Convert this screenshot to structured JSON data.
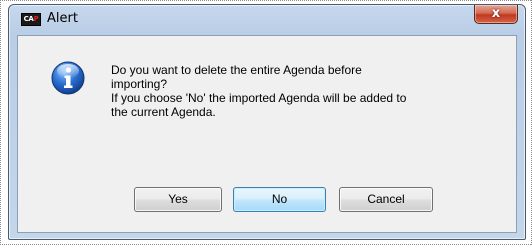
{
  "window": {
    "title": "Alert",
    "app_logo_text_white": "CA",
    "app_logo_text_red": "P"
  },
  "title_bar": {
    "close_glyph": "x"
  },
  "dialog": {
    "icon": "information-icon",
    "message_lines": [
      "Do you want to delete the entire Agenda before",
      "importing?",
      "If you choose 'No' the imported Agenda will be added to",
      "the current Agenda."
    ]
  },
  "buttons": {
    "yes": "Yes",
    "no": "No",
    "cancel": "Cancel",
    "default": "no"
  },
  "colors": {
    "info_icon_blue": "#2a6fd1",
    "close_button_red": "#c2381f",
    "title_bar_blue": "#b9cde6"
  }
}
